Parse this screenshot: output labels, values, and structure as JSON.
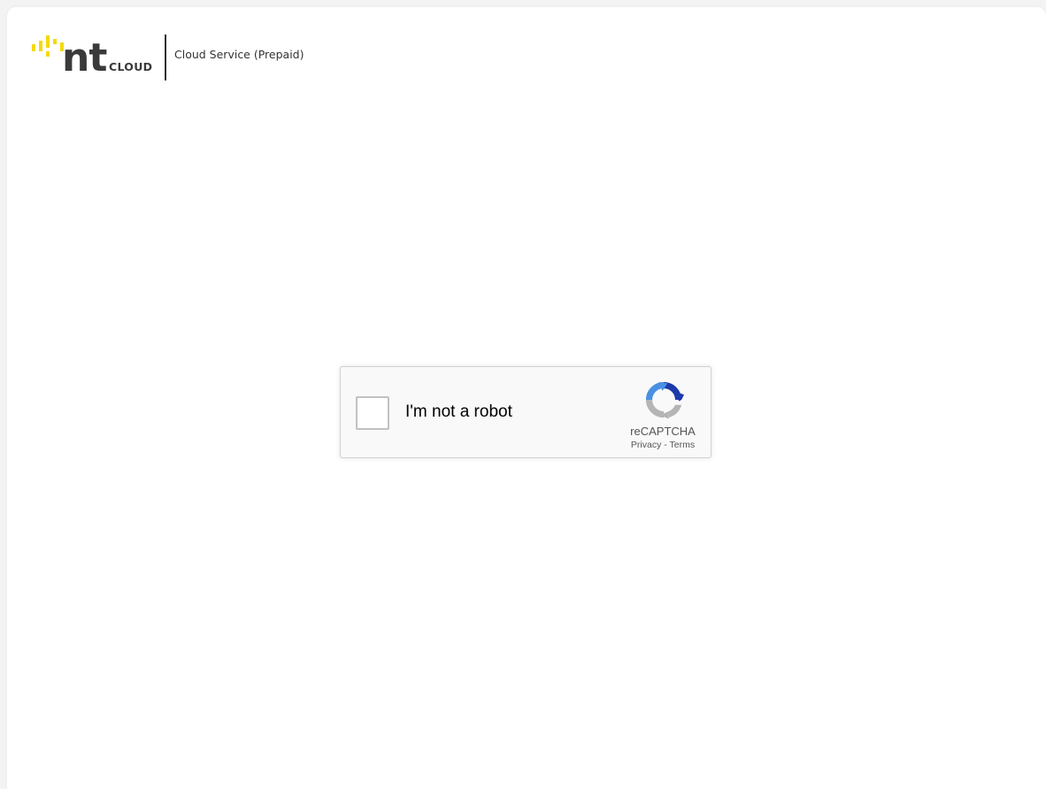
{
  "header": {
    "logo": {
      "wordmark": "nt",
      "suffix": "CLOUD",
      "brand_color": "#f5d90a",
      "text_color": "#3a3a3a"
    },
    "service_title": "Cloud Service (Prepaid)"
  },
  "captcha": {
    "checkbox_label": "I'm not a robot",
    "checked": false,
    "brand": "reCAPTCHA",
    "privacy_link": "Privacy",
    "separator": "-",
    "terms_link": "Terms",
    "icon": "recaptcha-icon",
    "colors": {
      "blue_dark": "#1c3aa9",
      "blue": "#4a90e2",
      "gray": "#b5b5b5"
    }
  }
}
